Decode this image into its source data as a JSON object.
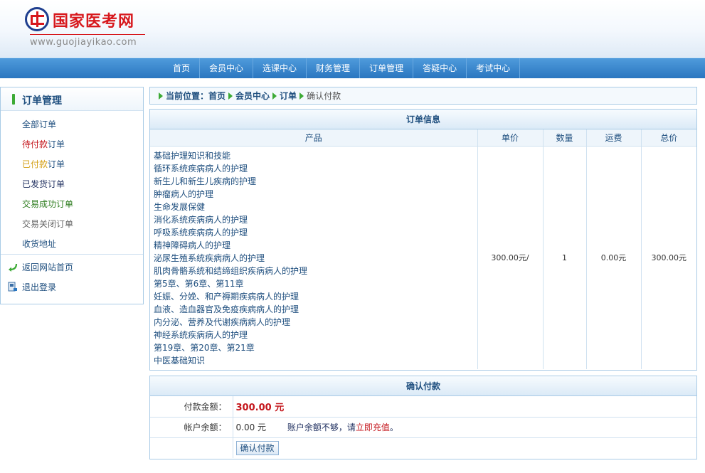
{
  "header": {
    "logo_title": "国家医考网",
    "logo_url": "www.guojiayikao.com"
  },
  "nav": {
    "items": [
      "首页",
      "会员中心",
      "选课中心",
      "财务管理",
      "订单管理",
      "答疑中心",
      "考试中心"
    ]
  },
  "sidebar": {
    "title": "订单管理",
    "links": [
      {
        "label": "全部订单",
        "color": "#1f4f7f"
      },
      {
        "label_prefix": "待付款",
        "label_suffix": "订单",
        "prefix_color": "#c4161c"
      },
      {
        "label_prefix": "已付款",
        "label_suffix": "订单",
        "prefix_color": "#d4a017"
      },
      {
        "label": "已发货订单",
        "color": "#1f2f5f"
      },
      {
        "label": "交易成功订单",
        "color": "#2e7d1f"
      },
      {
        "label": "交易关闭订单",
        "color": "#666666"
      },
      {
        "label": "收货地址",
        "color": "#1f4f7f"
      }
    ],
    "back_home": "返回网站首页",
    "logout": "退出登录"
  },
  "breadcrumb": {
    "prefix": "当前位置：",
    "items": [
      "首页",
      "会员中心",
      "订单"
    ],
    "current": "确认付款"
  },
  "order": {
    "title": "订单信息",
    "columns": [
      "产品",
      "单价",
      "数量",
      "运费",
      "总价"
    ],
    "products": [
      "基础护理知识和技能",
      "循环系统疾病病人的护理",
      "新生儿和新生儿疾病的护理",
      "肿瘤病人的护理",
      "生命发展保健",
      "消化系统疾病病人的护理",
      "呼吸系统疾病病人的护理",
      "精神障碍病人的护理",
      "泌尿生殖系统疾病病人的护理",
      "肌肉骨骼系统和结缔组织疾病病人的护理",
      "第5章、第6章、第11章",
      "妊娠、分娩、和产褥期疾病病人的护理",
      "血液、造血器官及免疫疾病病人的护理",
      "内分泌、营养及代谢疾病病人的护理",
      "神经系统疾病病人的护理",
      "第19章、第20章、第21章",
      "中医基础知识"
    ],
    "unit_price": "300.00元/",
    "quantity": "1",
    "shipping": "0.00元",
    "total": "300.00元"
  },
  "payment": {
    "title": "确认付款",
    "amount_label": "付款金额：",
    "amount_value": "300.00 元",
    "balance_label": "帐户余额：",
    "balance_value": "0.00 元",
    "notice_prefix": "账户余额不够，请",
    "recharge_link": "立即充值",
    "notice_suffix": "。",
    "confirm_button": "确认付款"
  }
}
